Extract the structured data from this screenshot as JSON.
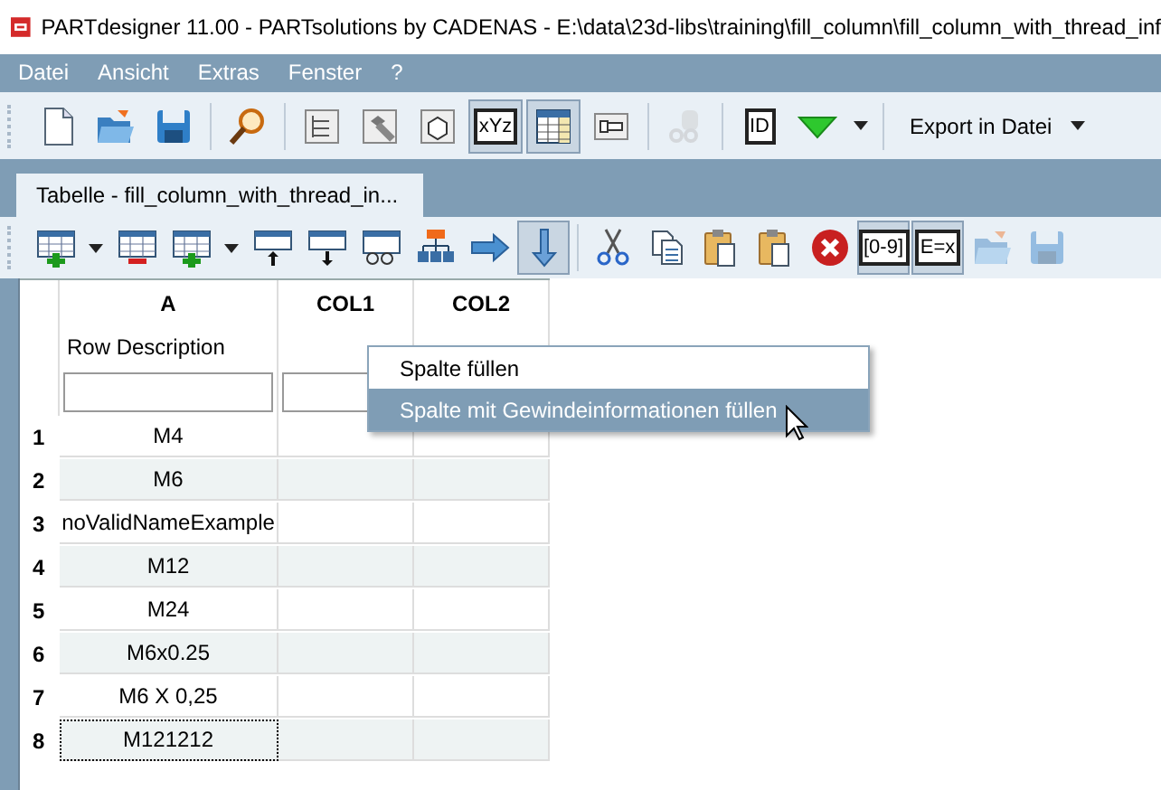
{
  "window": {
    "title": "PARTdesigner 11.00 - PARTsolutions by CADENAS - E:\\data\\23d-libs\\training\\fill_column\\fill_column_with_thread_inf"
  },
  "menu": [
    "Datei",
    "Ansicht",
    "Extras",
    "Fenster",
    "?"
  ],
  "toolbar": [
    {
      "kind": "new-document",
      "pressed": false,
      "disabled": false
    },
    {
      "kind": "open-folder",
      "pressed": false,
      "disabled": false
    },
    {
      "kind": "save",
      "pressed": false,
      "disabled": false
    },
    {
      "kind": "separator"
    },
    {
      "kind": "magnifier",
      "pressed": false,
      "disabled": false
    },
    {
      "kind": "separator"
    },
    {
      "kind": "tree",
      "pressed": false,
      "disabled": false
    },
    {
      "kind": "bolt",
      "pressed": false,
      "disabled": false
    },
    {
      "kind": "cube",
      "pressed": false,
      "disabled": false
    },
    {
      "kind": "text-icon",
      "label": "xYz",
      "pressed": true,
      "disabled": false
    },
    {
      "kind": "table",
      "pressed": true,
      "disabled": false
    },
    {
      "kind": "bolt-side",
      "pressed": false,
      "disabled": false
    },
    {
      "kind": "separator"
    },
    {
      "kind": "gears",
      "pressed": false,
      "disabled": true
    },
    {
      "kind": "separator"
    },
    {
      "kind": "text-icon",
      "label": "ID",
      "pressed": false,
      "disabled": false
    },
    {
      "kind": "triangle",
      "pressed": false,
      "disabled": false
    },
    {
      "kind": "caret",
      "pressed": false,
      "disabled": false
    },
    {
      "kind": "separator"
    },
    {
      "kind": "text-button",
      "label": "Export in Datei",
      "pressed": false,
      "disabled": false
    }
  ],
  "document_tab": {
    "label": "Tabelle - fill_column_with_thread_in...",
    "selected": true
  },
  "table_toolbar": [
    {
      "kind": "row-add",
      "pressed": false,
      "disabled": false
    },
    {
      "kind": "caret",
      "pressed": false,
      "disabled": false
    },
    {
      "kind": "row-remove",
      "pressed": false,
      "disabled": false
    },
    {
      "kind": "column-add",
      "pressed": false,
      "disabled": false
    },
    {
      "kind": "caret",
      "pressed": false,
      "disabled": false
    },
    {
      "kind": "move-up",
      "pressed": false,
      "disabled": false
    },
    {
      "kind": "move-down",
      "pressed": false,
      "disabled": false
    },
    {
      "kind": "table-glasses",
      "pressed": false,
      "disabled": false
    },
    {
      "kind": "hierarchy",
      "pressed": false,
      "disabled": false
    },
    {
      "kind": "arrow-right",
      "pressed": false,
      "disabled": false
    },
    {
      "kind": "arrow-down",
      "pressed": true,
      "disabled": false
    },
    {
      "kind": "separator"
    },
    {
      "kind": "scissors",
      "pressed": false,
      "disabled": false
    },
    {
      "kind": "copy",
      "pressed": false,
      "disabled": false
    },
    {
      "kind": "paste",
      "pressed": false,
      "disabled": false
    },
    {
      "kind": "paste",
      "pressed": false,
      "disabled": false
    },
    {
      "kind": "delete",
      "pressed": false,
      "disabled": false
    },
    {
      "kind": "text-icon",
      "label": "[0-9]",
      "pressed": true,
      "disabled": false
    },
    {
      "kind": "text-icon",
      "label": "E=x",
      "pressed": true,
      "disabled": false
    },
    {
      "kind": "open-folder",
      "pressed": false,
      "disabled": true
    },
    {
      "kind": "save",
      "pressed": false,
      "disabled": true
    }
  ],
  "table": {
    "columns": [
      {
        "name": "A",
        "description": "Row Description",
        "has_field": true
      },
      {
        "name": "COL1",
        "has_field": true
      },
      {
        "name": "COL2",
        "has_field": false
      }
    ],
    "rows": [
      {
        "number": "1",
        "cells": [
          "M4",
          "",
          ""
        ],
        "focused": false
      },
      {
        "number": "2",
        "cells": [
          "M6",
          "",
          ""
        ],
        "focused": false
      },
      {
        "number": "3",
        "cells": [
          "noValidNameExample",
          "",
          ""
        ],
        "focused": false
      },
      {
        "number": "4",
        "cells": [
          "M12",
          "",
          ""
        ],
        "focused": false
      },
      {
        "number": "5",
        "cells": [
          "M24",
          "",
          ""
        ],
        "focused": false
      },
      {
        "number": "6",
        "cells": [
          "M6x0.25",
          "",
          ""
        ],
        "focused": false
      },
      {
        "number": "7",
        "cells": [
          "M6 X 0,25",
          "",
          ""
        ],
        "focused": false
      },
      {
        "number": "8",
        "cells": [
          "M121212",
          "",
          ""
        ],
        "focused": true
      }
    ]
  },
  "context_menu": [
    {
      "label": "Spalte füllen",
      "selected": false
    },
    {
      "label": "Spalte mit Gewindeinformationen füllen",
      "selected": true
    }
  ]
}
